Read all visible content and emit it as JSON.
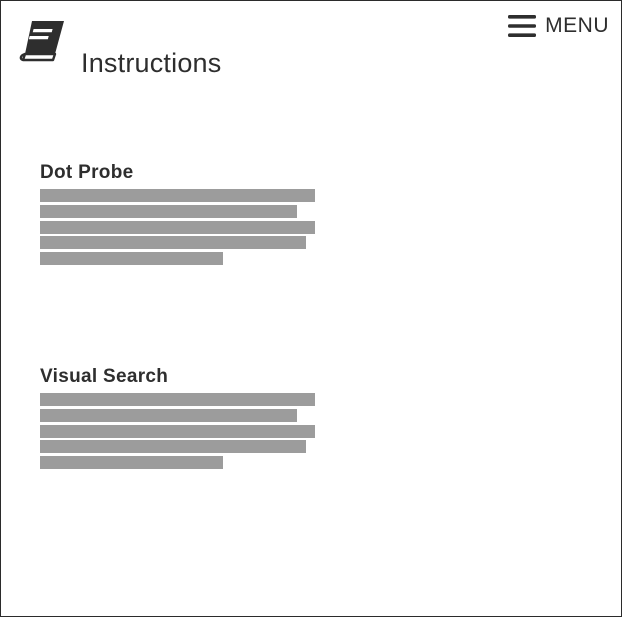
{
  "header": {
    "title": "Instructions",
    "icon": "book-icon",
    "menu_icon": "hamburger-icon",
    "menu_label": "MENU"
  },
  "sections": [
    {
      "title": "Dot Probe",
      "placeholder_lines": 5
    },
    {
      "title": "Visual Search",
      "placeholder_lines": 5
    }
  ],
  "colors": {
    "text": "#2e2e2e",
    "placeholder_bar": "#9c9c9c",
    "background": "#ffffff",
    "frame_border": "#2b2b2b"
  }
}
